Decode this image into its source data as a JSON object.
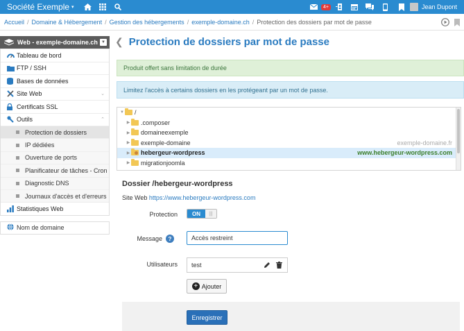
{
  "topbar": {
    "brand": "Société Exemple",
    "notif_count": "4+",
    "user_name": "Jean Dupont",
    "brand_color": "#2a8bd0"
  },
  "breadcrumb": {
    "items": [
      "Accueil",
      "Domaine & Hébergement",
      "Gestion des hébergements",
      "exemple-domaine.ch"
    ],
    "current": "Protection des dossiers par mot de passe"
  },
  "sidebar": {
    "header": "Web - exemple-domaine.ch",
    "items": [
      {
        "label": "Tableau de bord",
        "icon": "gauge-icon"
      },
      {
        "label": "FTP / SSH",
        "icon": "folder-icon"
      },
      {
        "label": "Bases de données",
        "icon": "database-icon"
      },
      {
        "label": "Site Web",
        "icon": "tools-icon"
      },
      {
        "label": "Certificats SSL",
        "icon": "lock-icon"
      },
      {
        "label": "Outils",
        "icon": "wrench-icon"
      }
    ],
    "subitems": [
      "Protection de dossiers",
      "IP dédiées",
      "Ouverture de ports",
      "Planificateur de tâches - Cron",
      "Diagnostic DNS",
      "Journaux d'accès et d'erreurs"
    ],
    "stats": "Statistiques Web",
    "domain": "Nom de domaine"
  },
  "page": {
    "title": "Protection de dossiers par mot de passe",
    "alert_success": "Produit offert sans limitation de durée",
    "alert_info": "Limitez l'accès à certains dossiers en les protégeant par un mot de passe."
  },
  "tree": {
    "root": "/",
    "nodes": [
      {
        "name": ".composer",
        "domain": ""
      },
      {
        "name": "domaineexemple",
        "domain": ""
      },
      {
        "name": "exemple-domaine",
        "domain": "exemple-domaine.fr"
      },
      {
        "name": "hebergeur-wordpress",
        "domain": "www.hebergeur-wordpress.com"
      },
      {
        "name": "migrationjoomla",
        "domain": ""
      }
    ]
  },
  "detail": {
    "heading": "Dossier /hebergeur-wordpress",
    "site_label": "Site Web",
    "site_url": "https://www.hebergeur-wordpress.com",
    "protection_label": "Protection",
    "toggle_on": "ON",
    "message_label": "Message",
    "message_value": "Accès restreint",
    "users_label": "Utilisateurs",
    "users": [
      "test"
    ],
    "add_label": "Ajouter",
    "save_label": "Enregistrer"
  }
}
